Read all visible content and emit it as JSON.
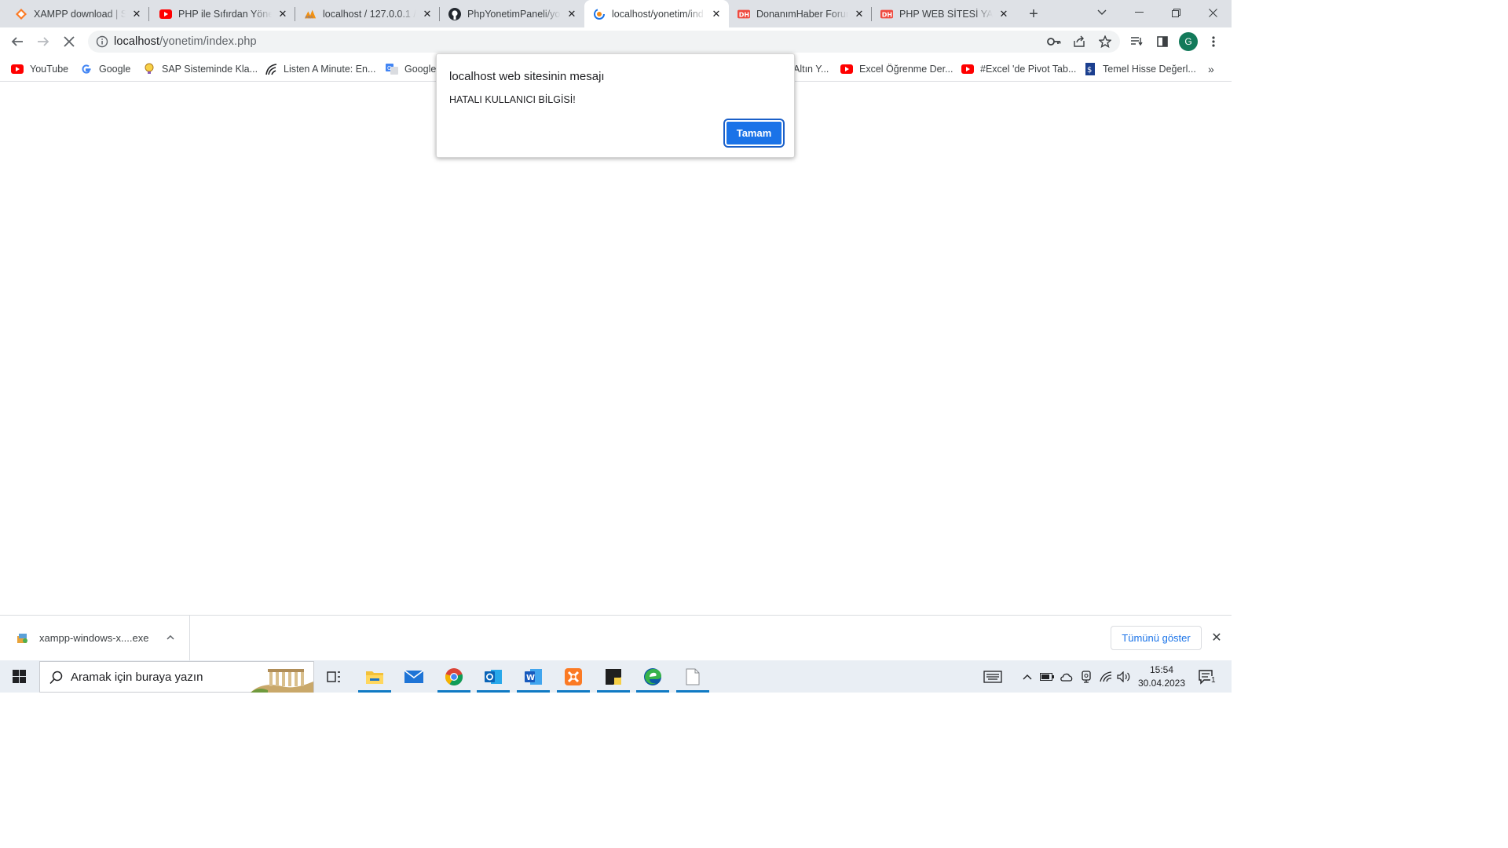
{
  "tabs": [
    {
      "title": "XAMPP download | Sc",
      "icon": "xampp-icon",
      "active": false
    },
    {
      "title": "PHP ile Sıfırdan Yönet",
      "icon": "youtube-icon",
      "active": false
    },
    {
      "title": "localhost / 127.0.0.1 /",
      "icon": "phpmyadmin-icon",
      "active": false
    },
    {
      "title": "PhpYonetimPaneli/yo",
      "icon": "github-icon",
      "active": false
    },
    {
      "title": "localhost/yonetim/ind",
      "icon": "loading-icon",
      "active": true
    },
    {
      "title": "DonanımHaber Forum",
      "icon": "donanimhaber-icon",
      "active": false
    },
    {
      "title": "PHP WEB SİTESİ YAPI",
      "icon": "donanimhaber-icon",
      "active": false
    }
  ],
  "address_bar": {
    "host": "localhost",
    "path": "/yonetim/index.php"
  },
  "profile": {
    "initial": "G",
    "color": "#137a5a"
  },
  "bookmarks": [
    {
      "label": "YouTube",
      "icon": "youtube-icon"
    },
    {
      "label": "Google",
      "icon": "google-icon"
    },
    {
      "label": "SAP Sisteminde Kla...",
      "icon": "sap-bulb-icon"
    },
    {
      "label": "Listen A Minute: En...",
      "icon": "listen-minute-icon"
    },
    {
      "label": "Google",
      "icon": "google-translate-icon"
    },
    {
      "label": "Altın Y...",
      "icon": "none"
    },
    {
      "label": "Excel Öğrenme Der...",
      "icon": "youtube-icon"
    },
    {
      "label": "#Excel 'de Pivot Tab...",
      "icon": "youtube-icon"
    },
    {
      "label": "Temel Hisse Değerl...",
      "icon": "bank-icon"
    }
  ],
  "dialog": {
    "title": "localhost web sitesinin mesajı",
    "message": "HATALI KULLANICI BİLGİSİ!",
    "ok_label": "Tamam"
  },
  "download_shelf": {
    "file_name": "xampp-windows-x....exe",
    "show_all_label": "Tümünü göster"
  },
  "taskbar": {
    "search_placeholder": "Aramak için buraya yazın",
    "apps": [
      "task-view-icon",
      "file-explorer-icon",
      "mail-icon",
      "chrome-icon",
      "outlook-icon",
      "word-icon",
      "xampp-icon",
      "sticky-notes-icon",
      "edge-icon",
      "blank-document-icon"
    ],
    "time": "15:54",
    "date": "30.04.2023",
    "notification_count": "1"
  },
  "colors": {
    "accent": "#1a73e8",
    "tabstrip_bg": "#dee1e6",
    "taskbar_bg": "#e9eef4"
  }
}
